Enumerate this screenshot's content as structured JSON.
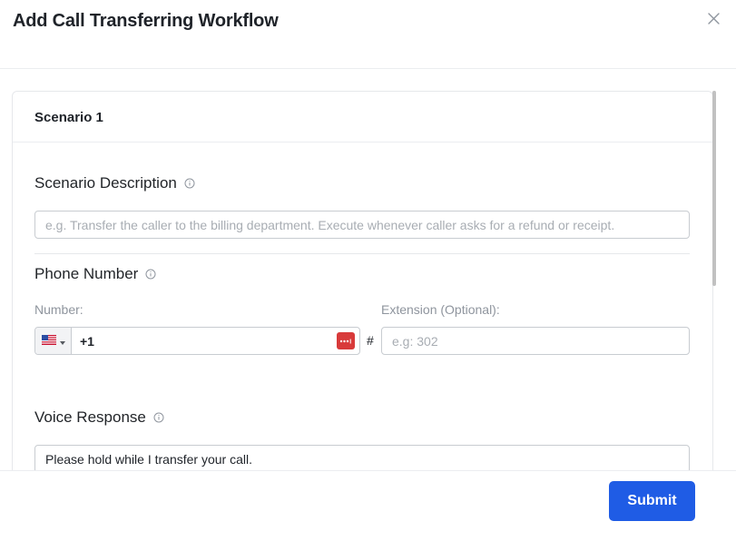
{
  "modal": {
    "title": "Add Call Transferring Workflow",
    "close_icon": "close-icon"
  },
  "scenario": {
    "title": "Scenario 1",
    "description": {
      "label": "Scenario Description",
      "info_icon": "info-icon",
      "placeholder": "e.g. Transfer the caller to the billing department. Execute whenever caller asks for a refund or receipt.",
      "value": ""
    },
    "phone": {
      "label": "Phone Number",
      "info_icon": "info-icon",
      "number_label": "Number:",
      "country_flag_icon": "us-flag-icon",
      "country_dropdown_icon": "caret-down-icon",
      "number_value": "+1",
      "autofill_icon": "password-manager-icon",
      "hash": "#",
      "extension_label": "Extension (Optional):",
      "extension_placeholder": "e.g: 302",
      "extension_value": ""
    },
    "voice_response": {
      "label": "Voice Response",
      "info_icon": "info-icon",
      "value": "Please hold while I transfer your call."
    }
  },
  "footer": {
    "submit_label": "Submit"
  },
  "colors": {
    "primary": "#1f5ce5",
    "autofill_badge": "#d83a3a",
    "border": "#c8ccd1",
    "muted_text": "#8f959e"
  }
}
